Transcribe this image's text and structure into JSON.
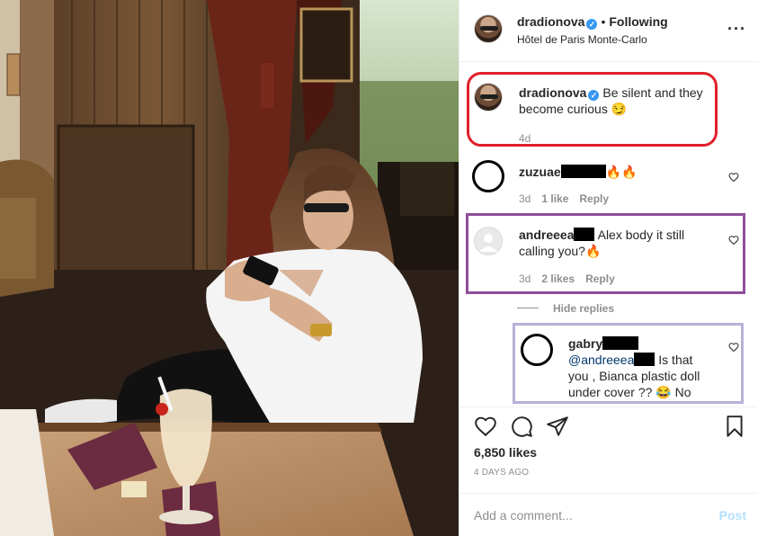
{
  "post": {
    "username": "dradionova",
    "following_label": "Following",
    "location": "Hôtel de Paris Monte-Carlo",
    "more_icon": "more-horizontal-icon"
  },
  "caption": {
    "username": "dradionova",
    "text": "Be silent and they become curious 😏",
    "age": "4d"
  },
  "comments": [
    {
      "username": "zuzuae",
      "text": "🔥🔥",
      "age": "3d",
      "likes": "1 like",
      "reply": "Reply"
    },
    {
      "username": "andreeea",
      "text": " Alex body it still calling you?🔥",
      "age": "3d",
      "likes": "2 likes",
      "reply": "Reply"
    }
  ],
  "hide_replies": "Hide replies",
  "reply": {
    "username": "gabry",
    "mention": "@andreeea",
    "text": "Is that you , Bianca plastic doll under cover ?? 😂 No"
  },
  "actions": {
    "likes": "6,850 likes",
    "posted": "4 DAYS AGO"
  },
  "add_comment": {
    "placeholder": "Add a comment...",
    "post_label": "Post"
  },
  "colors": {
    "highlight_red": "#e0202a",
    "highlight_purple": "#8e4e9c",
    "highlight_lavender": "#b9b0d8",
    "verified": "#3897f0",
    "post_disabled": "#b2dffc"
  }
}
